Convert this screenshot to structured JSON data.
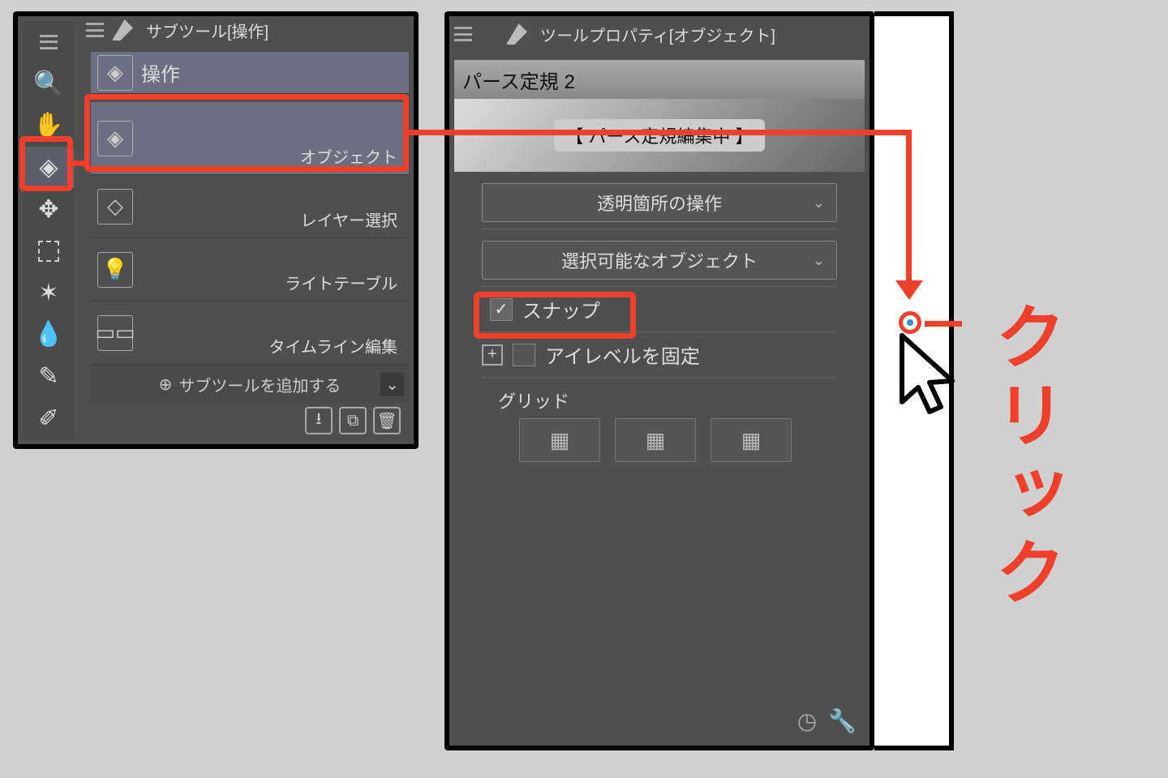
{
  "subtool": {
    "title": "サブツール[操作]",
    "group": "操作",
    "items": [
      {
        "label": "オブジェクト",
        "icon": "cube-cursor"
      },
      {
        "label": "レイヤー選択",
        "icon": "layer-cursor"
      },
      {
        "label": "ライトテーブル",
        "icon": "bulb"
      },
      {
        "label": "タイムライン編集",
        "icon": "timeline"
      }
    ],
    "add": "サブツールを追加する"
  },
  "prop": {
    "title": "ツールプロパティ[オブジェクト]",
    "ruler": "パース定規 2",
    "editing": "【 パース定規編集中 】",
    "transparent": "透明箇所の操作",
    "selectable": "選択可能なオブジェクト",
    "snap": "スナップ",
    "eyelevel": "アイレベルを固定",
    "grid": "グリッド"
  },
  "anno": {
    "click": "クリック"
  }
}
